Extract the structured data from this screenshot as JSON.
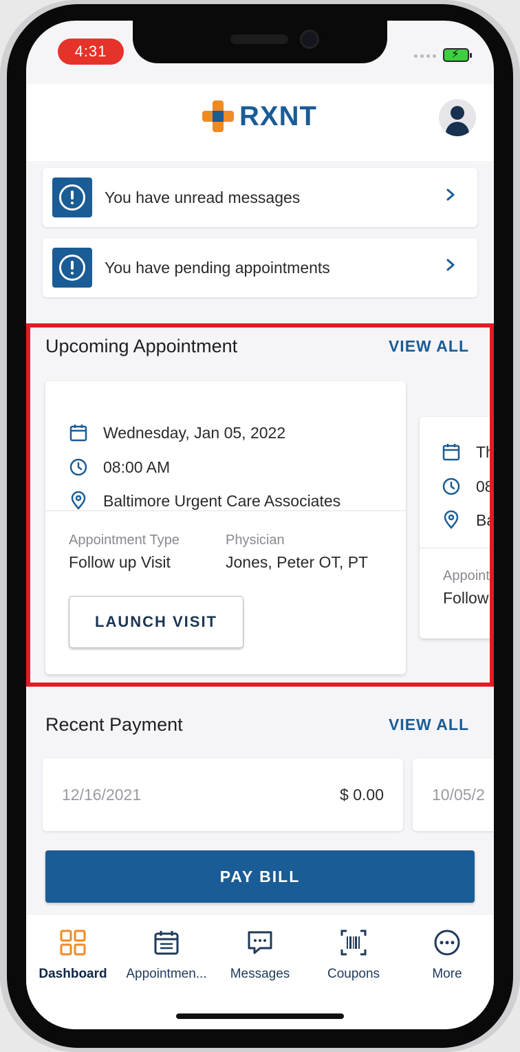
{
  "status_bar": {
    "time": "4:31"
  },
  "app": {
    "brand": "RXNT"
  },
  "alerts": [
    {
      "text": "You have unread messages"
    },
    {
      "text": "You have pending appointments"
    }
  ],
  "upcoming": {
    "title": "Upcoming Appointment",
    "view_all": "VIEW ALL",
    "card": {
      "date": "Wednesday, Jan 05, 2022",
      "time": "08:00 AM",
      "location": "Baltimore Urgent Care Associates",
      "type_label": "Appointment Type",
      "type_value": "Follow up Visit",
      "physician_label": "Physician",
      "physician_value": "Jones, Peter OT, PT",
      "launch_label": "LAUNCH VISIT"
    },
    "card2": {
      "date": "Th",
      "time": "08",
      "location": "Ba",
      "type_label": "Appoint",
      "type_value": "Follow"
    }
  },
  "payments": {
    "title": "Recent Payment",
    "view_all": "VIEW ALL",
    "items": [
      {
        "date": "12/16/2021",
        "amount": "$ 0.00"
      },
      {
        "date": "10/05/2"
      }
    ],
    "pay_bill": "PAY BILL"
  },
  "tabs": [
    {
      "label": "Dashboard",
      "icon": "grid-icon",
      "active": true
    },
    {
      "label": "Appointmen...",
      "icon": "calendar-icon"
    },
    {
      "label": "Messages",
      "icon": "message-icon"
    },
    {
      "label": "Coupons",
      "icon": "barcode-icon"
    },
    {
      "label": "More",
      "icon": "more-icon"
    }
  ],
  "colors": {
    "brand_blue": "#1a5c95",
    "brand_orange": "#f08a24",
    "highlight_red": "#e21c25",
    "time_pill": "#e5332a"
  }
}
